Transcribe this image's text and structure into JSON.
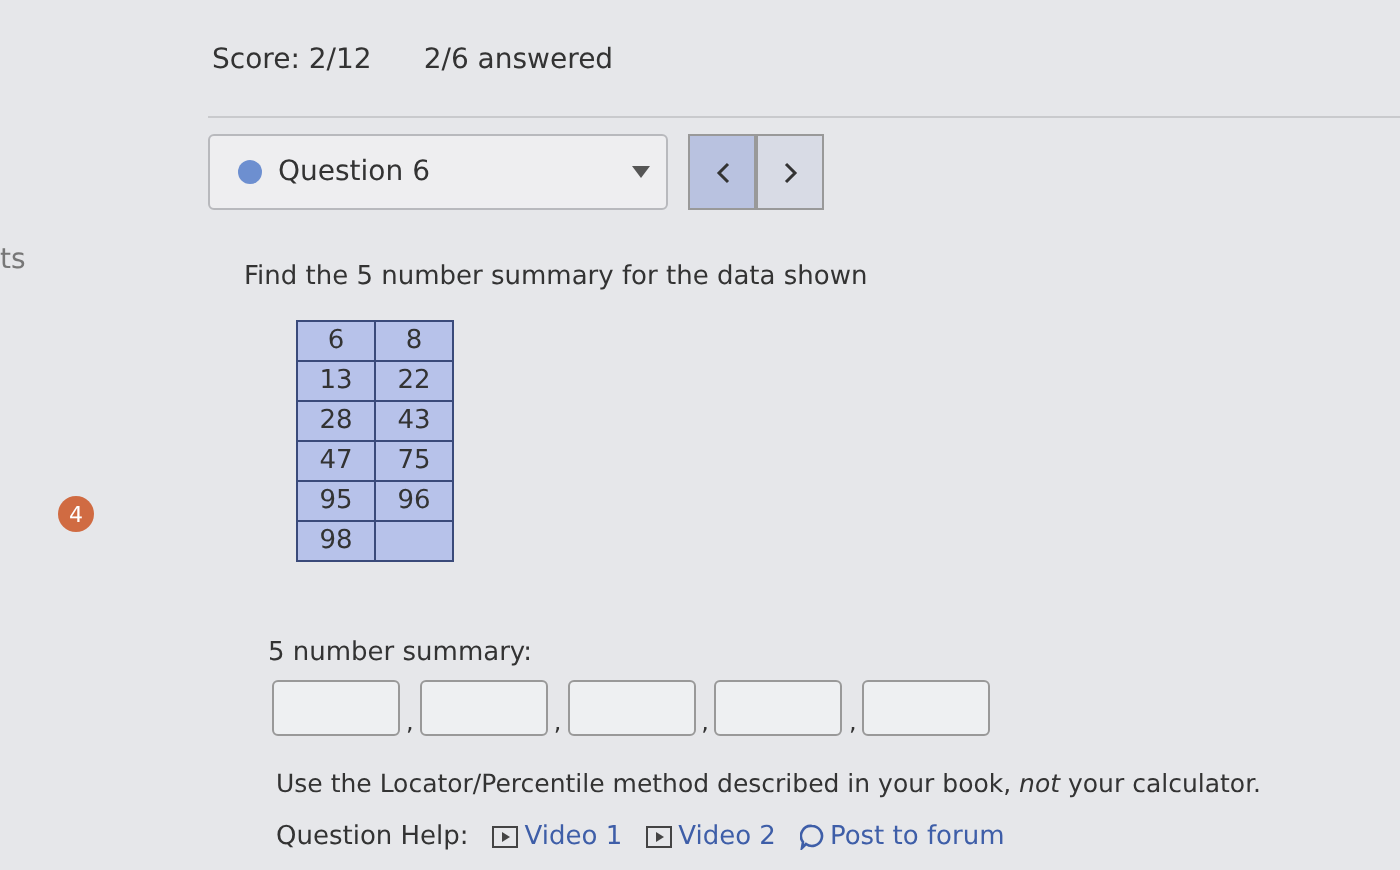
{
  "side_label": "ts",
  "step_badge": "4",
  "header": {
    "score": "Score: 2/12",
    "answered": "2/6 answered"
  },
  "question_select": {
    "label": "Question 6"
  },
  "prompt": "Find the 5 number summary for the data shown",
  "data_table": {
    "rows": [
      [
        "6",
        "8"
      ],
      [
        "13",
        "22"
      ],
      [
        "28",
        "43"
      ],
      [
        "47",
        "75"
      ],
      [
        "95",
        "96"
      ],
      [
        "98"
      ]
    ]
  },
  "answer_label": "5 number summary:",
  "answer_separators": [
    ",",
    ",",
    ",",
    ","
  ],
  "instruction": "Use the Locator/Percentile method described in your book, *not* your calculator.",
  "help": {
    "label": "Question Help:",
    "links": [
      {
        "kind": "video",
        "label": "Video 1"
      },
      {
        "kind": "video",
        "label": "Video 2"
      },
      {
        "kind": "forum",
        "label": "Post to forum"
      }
    ]
  }
}
